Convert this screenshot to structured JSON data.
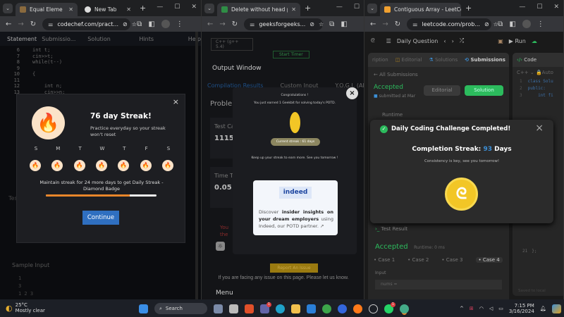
{
  "codechef": {
    "tabs": [
      {
        "label": "Equal Eleme",
        "active": true
      },
      {
        "label": "New Tab",
        "active": false
      }
    ],
    "url": "codechef.com/pract...",
    "nav": [
      "Statement",
      "Submissio...",
      "Solution",
      "Hints",
      "Help"
    ],
    "code_lines": [
      {
        "n": "6",
        "t": "int t;"
      },
      {
        "n": "7",
        "t": "cin>>t;"
      },
      {
        "n": "8",
        "t": "while(t--)"
      },
      {
        "n": "9",
        "t": ""
      },
      {
        "n": "10",
        "t": "{"
      },
      {
        "n": "11",
        "t": ""
      },
      {
        "n": "12",
        "t": "    int n;"
      },
      {
        "n": "13",
        "t": "    cin>>n;"
      }
    ],
    "modal": {
      "title": "76 day Streak!",
      "subtitle": "Practice everyday so your streak won't reset",
      "days": [
        "S",
        "M",
        "T",
        "W",
        "T",
        "F",
        "S"
      ],
      "message": "Maintain streak for 24 more days to get Daily Streak - Diamond Badge",
      "progress": 0.76,
      "continue_label": "Continue",
      "close": "×"
    },
    "test_label": "Test",
    "sample_input_label": "Sample Input",
    "sample_lines": [
      "1",
      "3",
      "1 2 3"
    ]
  },
  "gfg": {
    "tab": "Delete without head pointer | P",
    "url": "geeksforgeeks...",
    "language": "C++ (g++ 5.4)",
    "start_timer": "Start Timer",
    "output_window": "Output Window",
    "tabs": [
      "Compilation Results",
      "Custom Input",
      "Y.O.G.I. (AI Bot)"
    ],
    "problem_label": "Problem",
    "test_cases_label": "Test Ca",
    "test_cases_value": "1115",
    "time_label": "Time Ta",
    "time_value": "0.05",
    "error_text": "You",
    "error_text2": "the",
    "modal": {
      "congrats": "Congratulations !",
      "earned": "You just earned 1 Geekbit for solving today's POTD.",
      "streak": "Current streak : 61 days",
      "keep_up": "Keep up your streak to earn more. See you tomorrow !",
      "ad_logo": "indeed",
      "ad_pre": "Discover ",
      "ad_bold": "insider insights on your dream employers",
      "ad_post": " using Indeed, our POTD partner.",
      "close": "×"
    },
    "report_issue": "Report An Issue",
    "issue_text": "If you are facing any issue on this page. Please let us know.",
    "menu": "Menu"
  },
  "leetcode": {
    "tab": "Contiguous Array - LeetCode",
    "url": "leetcode.com/prob...",
    "daily_question": "Daily Question",
    "run": "Run",
    "panel_tabs": [
      "ription",
      "Editorial",
      "Solutions",
      "Submissions"
    ],
    "all_submissions": "All Submissions",
    "accepted": "Accepted",
    "submitted": "submitted at Mar",
    "editorial_btn": "Editorial",
    "solution_btn": "Solution",
    "runtime": "Runtime",
    "code_label": "Code",
    "lang": "C++",
    "auto": "Auto",
    "code_lines": [
      {
        "n": "1",
        "t": "class Solu"
      },
      {
        "n": "2",
        "t": "public:"
      },
      {
        "n": "3",
        "t": "    int fi"
      }
    ],
    "code_end": {
      "n": "21",
      "t": "};"
    },
    "modal": {
      "title": "Daily Coding Challenge Completed!",
      "streak_label": "Completion Streak:",
      "streak_value": "93",
      "streak_unit": "Days",
      "subtitle": "Consistency is key, see you tomorrow!",
      "close": "×"
    },
    "test_result": "Test Result",
    "result_accepted": "Accepted",
    "result_runtime": "Runtime: 0 ms",
    "cases": [
      "Case 1",
      "Case 2",
      "Case 3",
      "Case 4"
    ],
    "input_label": "Input",
    "nums_label": "nums =",
    "saved": "Saved to local"
  },
  "taskbar": {
    "temp": "25°C",
    "weather": "Mostly clear",
    "search": "Search",
    "time": "7:15 PM",
    "date": "3/16/2024",
    "badge_teams": "1",
    "badge_whatsapp": "1"
  },
  "colors": {
    "accent_orange": "#e8862a",
    "continue_blue": "#2f6fc0",
    "lc_green": "#2cbb5d",
    "lc_blue": "#3c8fd6",
    "coin_yellow": "#f2c626"
  }
}
